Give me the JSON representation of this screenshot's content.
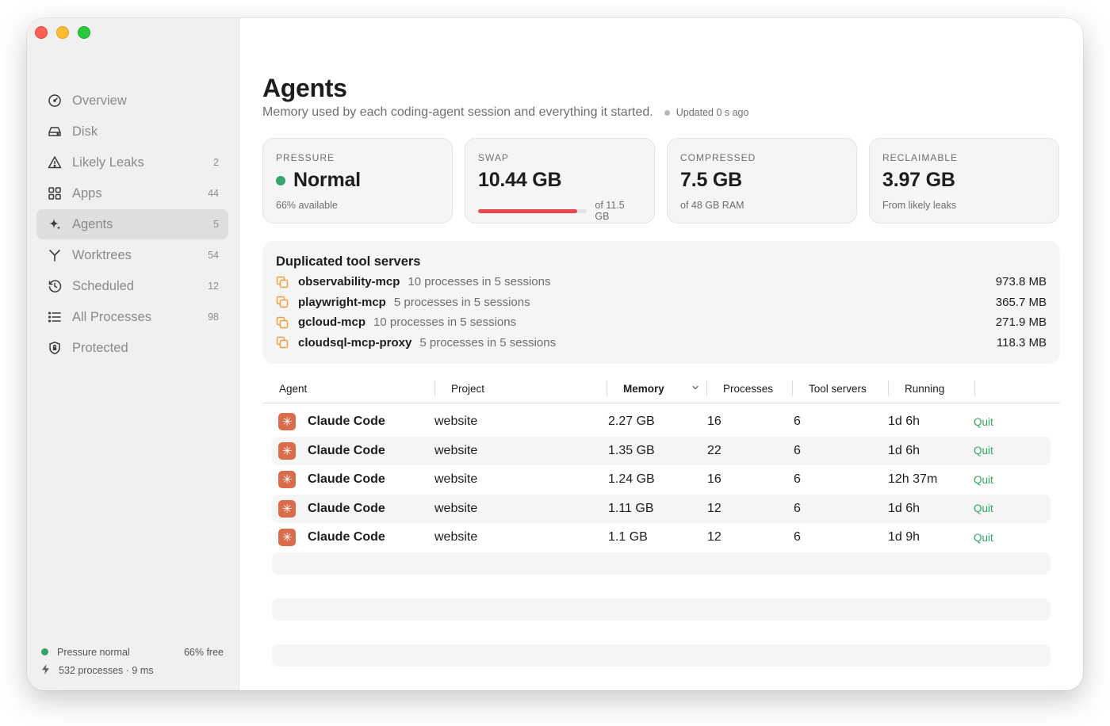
{
  "sidebar": {
    "items": [
      {
        "label": "Overview",
        "count": "",
        "icon": "gauge-icon"
      },
      {
        "label": "Disk",
        "count": "",
        "icon": "disk-icon"
      },
      {
        "label": "Likely Leaks",
        "count": "2",
        "icon": "warning-icon"
      },
      {
        "label": "Apps",
        "count": "44",
        "icon": "apps-grid-icon"
      },
      {
        "label": "Agents",
        "count": "5",
        "icon": "sparkle-icon",
        "active": true
      },
      {
        "label": "Worktrees",
        "count": "54",
        "icon": "branch-icon"
      },
      {
        "label": "Scheduled",
        "count": "12",
        "icon": "history-clock-icon"
      },
      {
        "label": "All Processes",
        "count": "98",
        "icon": "list-icon"
      },
      {
        "label": "Protected",
        "count": "",
        "icon": "shield-icon"
      }
    ],
    "footer": {
      "pressure": "Pressure normal",
      "free": "66% free",
      "processes": "532 processes · 9 ms"
    }
  },
  "header": {
    "title": "Agents",
    "subtitle": "Memory used by each coding-agent session and everything it started.",
    "updated": "Updated 0 s ago"
  },
  "cards": {
    "pressure": {
      "label": "PRESSURE",
      "value": "Normal",
      "sub": "66% available",
      "status_color": "#35a36a"
    },
    "swap": {
      "label": "SWAP",
      "value": "10.44 GB",
      "sub": "of 11.5 GB",
      "fill_fraction": 0.908,
      "bar_color": "#e5484d"
    },
    "compressed": {
      "label": "COMPRESSED",
      "value": "7.5 GB",
      "sub": "of 48 GB RAM"
    },
    "reclaimable": {
      "label": "RECLAIMABLE",
      "value": "3.97 GB",
      "sub": "From likely leaks"
    }
  },
  "dup": {
    "title": "Duplicated tool servers",
    "items": [
      {
        "name": "observability-mcp",
        "desc": "10 processes in 5 sessions",
        "mem": "973.8 MB"
      },
      {
        "name": "playwright-mcp",
        "desc": "5 processes in 5 sessions",
        "mem": "365.7 MB"
      },
      {
        "name": "gcloud-mcp",
        "desc": "10 processes in 5 sessions",
        "mem": "271.9 MB"
      },
      {
        "name": "cloudsql-mcp-proxy",
        "desc": "5 processes in 5 sessions",
        "mem": "118.3 MB"
      }
    ]
  },
  "table": {
    "headers": [
      "Agent",
      "Project",
      "Memory",
      "Processes",
      "Tool servers",
      "Running"
    ],
    "rows": [
      {
        "agent": "Claude Code",
        "project": "website",
        "memory": "2.27 GB",
        "processes": "16",
        "tools": "6",
        "running": "1d 6h",
        "action": "Quit"
      },
      {
        "agent": "Claude Code",
        "project": "website",
        "memory": "1.35 GB",
        "processes": "22",
        "tools": "6",
        "running": "1d 6h",
        "action": "Quit"
      },
      {
        "agent": "Claude Code",
        "project": "website",
        "memory": "1.24 GB",
        "processes": "16",
        "tools": "6",
        "running": "12h 37m",
        "action": "Quit"
      },
      {
        "agent": "Claude Code",
        "project": "website",
        "memory": "1.11 GB",
        "processes": "12",
        "tools": "6",
        "running": "1d 6h",
        "action": "Quit"
      },
      {
        "agent": "Claude Code",
        "project": "website",
        "memory": "1.1 GB",
        "processes": "12",
        "tools": "6",
        "running": "1d 9h",
        "action": "Quit"
      }
    ]
  }
}
